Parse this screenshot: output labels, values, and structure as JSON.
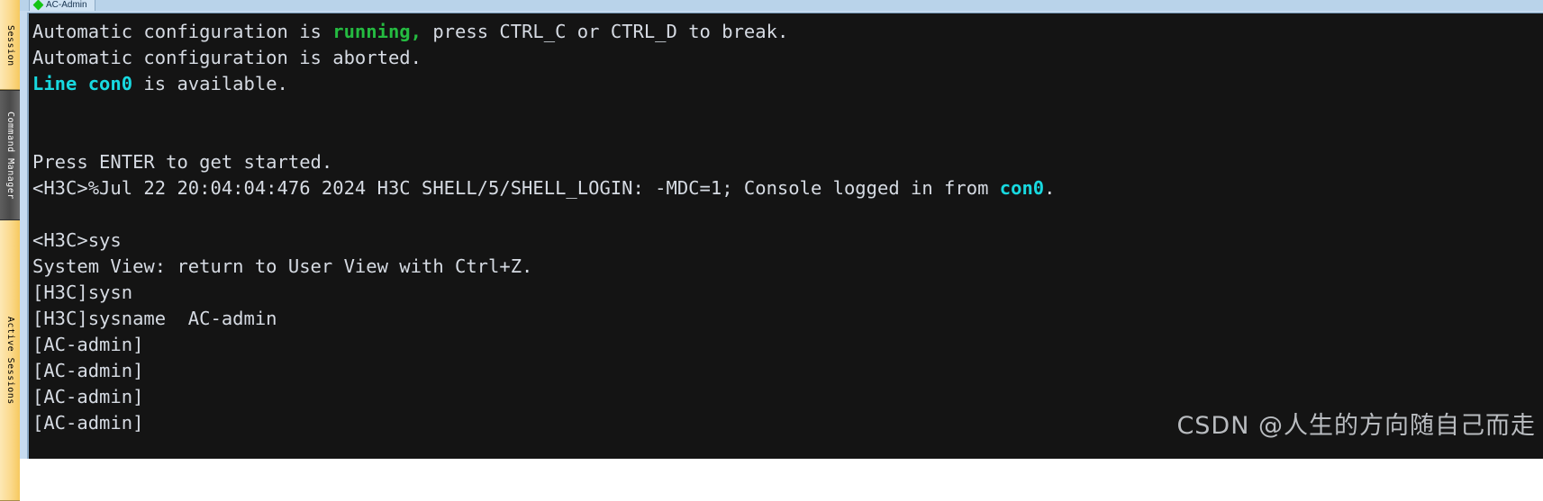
{
  "sidebar": {
    "tabs": [
      {
        "label": "Session Manager",
        "state": "inactive"
      },
      {
        "label": "Command Manager",
        "state": "active"
      },
      {
        "label": "Active Sessions",
        "state": "inactive"
      }
    ]
  },
  "tabstrip": {
    "tabs": [
      {
        "label": "AC-Admin",
        "icon": "green-diamond-icon"
      }
    ]
  },
  "terminal": {
    "background": "#141414",
    "foreground": "#d6dbe3",
    "accent_green": "#25bb41",
    "accent_cyan": "#18d9e0",
    "lines": [
      {
        "id": 1,
        "segments": [
          {
            "text": "Automatic configuration is ",
            "color": "white"
          },
          {
            "text": "running",
            "color": "green"
          },
          {
            "text": ",",
            "color": "green"
          },
          {
            "text": " press CTRL_C or CTRL_D to break.",
            "color": "white"
          }
        ]
      },
      {
        "id": 2,
        "segments": [
          {
            "text": "Automatic configuration is aborted.",
            "color": "white"
          }
        ]
      },
      {
        "id": 3,
        "segments": [
          {
            "text": "Line con0",
            "color": "cyan"
          },
          {
            "text": " is available.",
            "color": "white"
          }
        ]
      },
      {
        "id": 4,
        "segments": [
          {
            "text": "",
            "color": "white"
          }
        ]
      },
      {
        "id": 5,
        "segments": [
          {
            "text": "",
            "color": "white"
          }
        ]
      },
      {
        "id": 6,
        "segments": [
          {
            "text": "Press ENTER to get started.",
            "color": "white"
          }
        ]
      },
      {
        "id": 7,
        "segments": [
          {
            "text": "<H3C>%Jul 22 20:04:04:476 2024 H3C SHELL/5/SHELL_LOGIN: -MDC=1; Console logged in from ",
            "color": "white"
          },
          {
            "text": "con0",
            "color": "cyan"
          },
          {
            "text": ".",
            "color": "white"
          }
        ]
      },
      {
        "id": 8,
        "segments": [
          {
            "text": "",
            "color": "white"
          }
        ]
      },
      {
        "id": 9,
        "segments": [
          {
            "text": "<H3C>sys",
            "color": "white"
          }
        ]
      },
      {
        "id": 10,
        "segments": [
          {
            "text": "System View: return to User View with Ctrl+Z.",
            "color": "white"
          }
        ]
      },
      {
        "id": 11,
        "segments": [
          {
            "text": "[H3C]sysn",
            "color": "white"
          }
        ]
      },
      {
        "id": 12,
        "segments": [
          {
            "text": "[H3C]sysname  AC-admin",
            "color": "white"
          }
        ]
      },
      {
        "id": 13,
        "segments": [
          {
            "text": "[AC-admin]",
            "color": "white"
          }
        ]
      },
      {
        "id": 14,
        "segments": [
          {
            "text": "[AC-admin]",
            "color": "white"
          }
        ]
      },
      {
        "id": 15,
        "segments": [
          {
            "text": "[AC-admin]",
            "color": "white"
          }
        ]
      },
      {
        "id": 16,
        "segments": [
          {
            "text": "[AC-admin]",
            "color": "white"
          }
        ]
      }
    ]
  },
  "watermark": {
    "text": "CSDN @人生的方向随自己而走",
    "color": "#b9bcc0"
  }
}
